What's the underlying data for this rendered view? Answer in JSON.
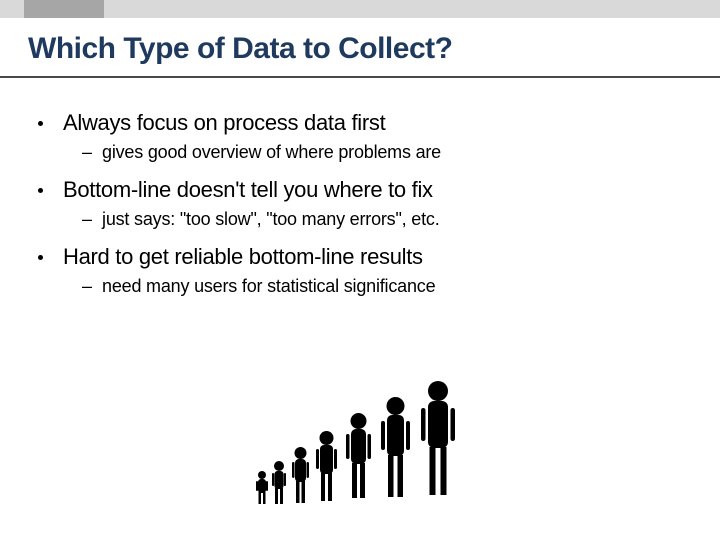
{
  "slide": {
    "title": "Which Type of Data to Collect?",
    "bullets": [
      {
        "text": "Always focus on process data first",
        "sub": "gives good overview of where problems are"
      },
      {
        "text": "Bottom-line doesn't tell you where to fix",
        "sub": "just says: \"too slow\", \"too many errors\", etc."
      },
      {
        "text": "Hard to get reliable bottom-line results",
        "sub": "need many users for statistical significance"
      }
    ]
  }
}
